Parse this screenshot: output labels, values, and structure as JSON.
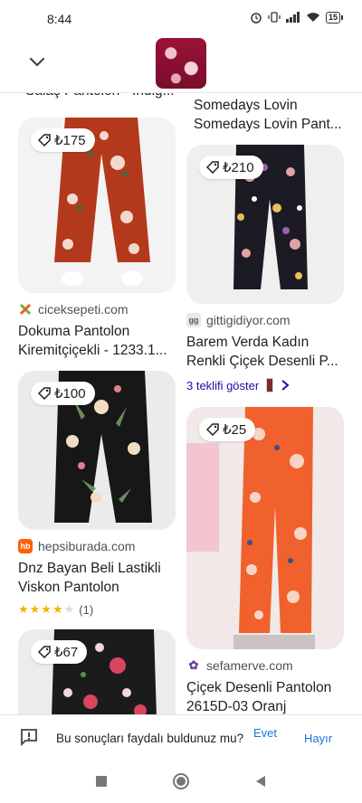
{
  "status": {
    "time": "8:44",
    "battery": "15"
  },
  "header": {
    "collapse_icon": "chevron-down-icon"
  },
  "top_partial": {
    "left_text": "Salaş Pantolon - İndig...",
    "right_line1": "Somedays Lovin",
    "right_line2": "Somedays Lovin Pant..."
  },
  "products": [
    {
      "price": "₺175",
      "source": "ciceksepeti.com",
      "title1": "Dokuma Pantolon",
      "title2": "Kiremitçiçekli - 1233.1..."
    },
    {
      "price": "₺210",
      "source": "gittigidiyor.com",
      "title1": "Barem Verda Kadın",
      "title2": "Renkli Çiçek Desenli P...",
      "offers": "3 teklifi göster"
    },
    {
      "price": "₺100",
      "source": "hepsiburada.com",
      "title1": "Dnz Bayan Beli Lastikli",
      "title2": "Viskon Pantolon",
      "rating_count": "(1)",
      "rating": 4
    },
    {
      "price": "₺25",
      "source": "sefamerve.com",
      "title1": "Çiçek Desenli Pantolon",
      "title2": "2615D-03 Oranj"
    },
    {
      "price": "₺67"
    }
  ],
  "feedback": {
    "question": "Bu sonuçları faydalı buldunuz mu?",
    "yes": "Evet",
    "no": "Hayır"
  },
  "colors": {
    "link": "#1a73e8",
    "star": "#f4b400"
  }
}
